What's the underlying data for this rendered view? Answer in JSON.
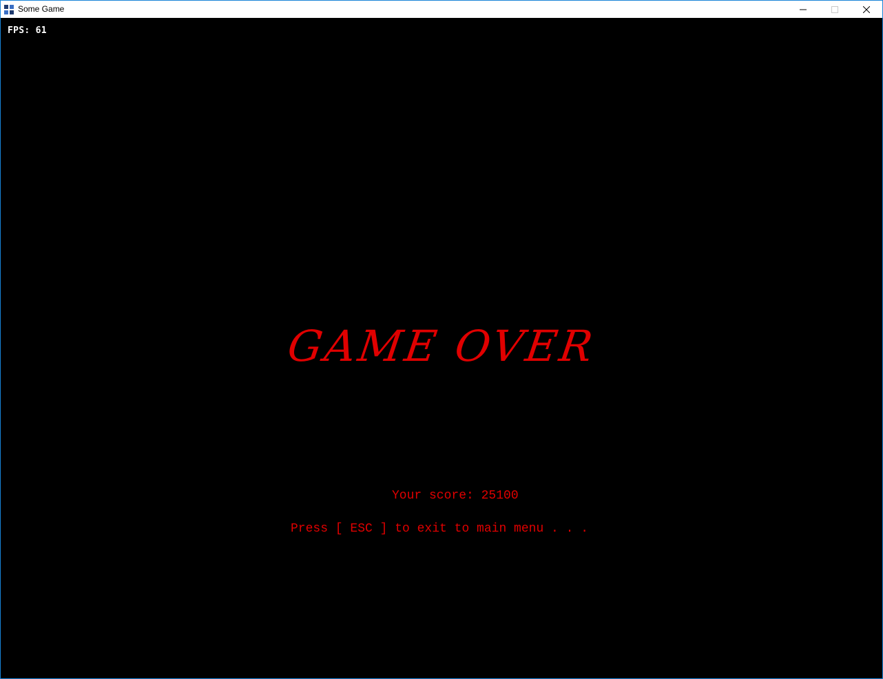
{
  "window": {
    "title": "Some Game",
    "icon": "app-icon",
    "controls": {
      "minimize_icon": "minimize-icon",
      "maximize_icon": "maximize-icon",
      "close_icon": "close-icon"
    },
    "accent_color": "#1883d7"
  },
  "hud": {
    "fps_label": "FPS:",
    "fps_value": "61",
    "fps_text": "FPS: 61"
  },
  "game_over": {
    "title": "GAME OVER",
    "score_label": "Your score:",
    "score_value": 25100,
    "score_text": "Your score: 25100",
    "exit_prompt": "Press [ ESC ] to exit to main menu . . .",
    "text_color": "#e00000"
  }
}
